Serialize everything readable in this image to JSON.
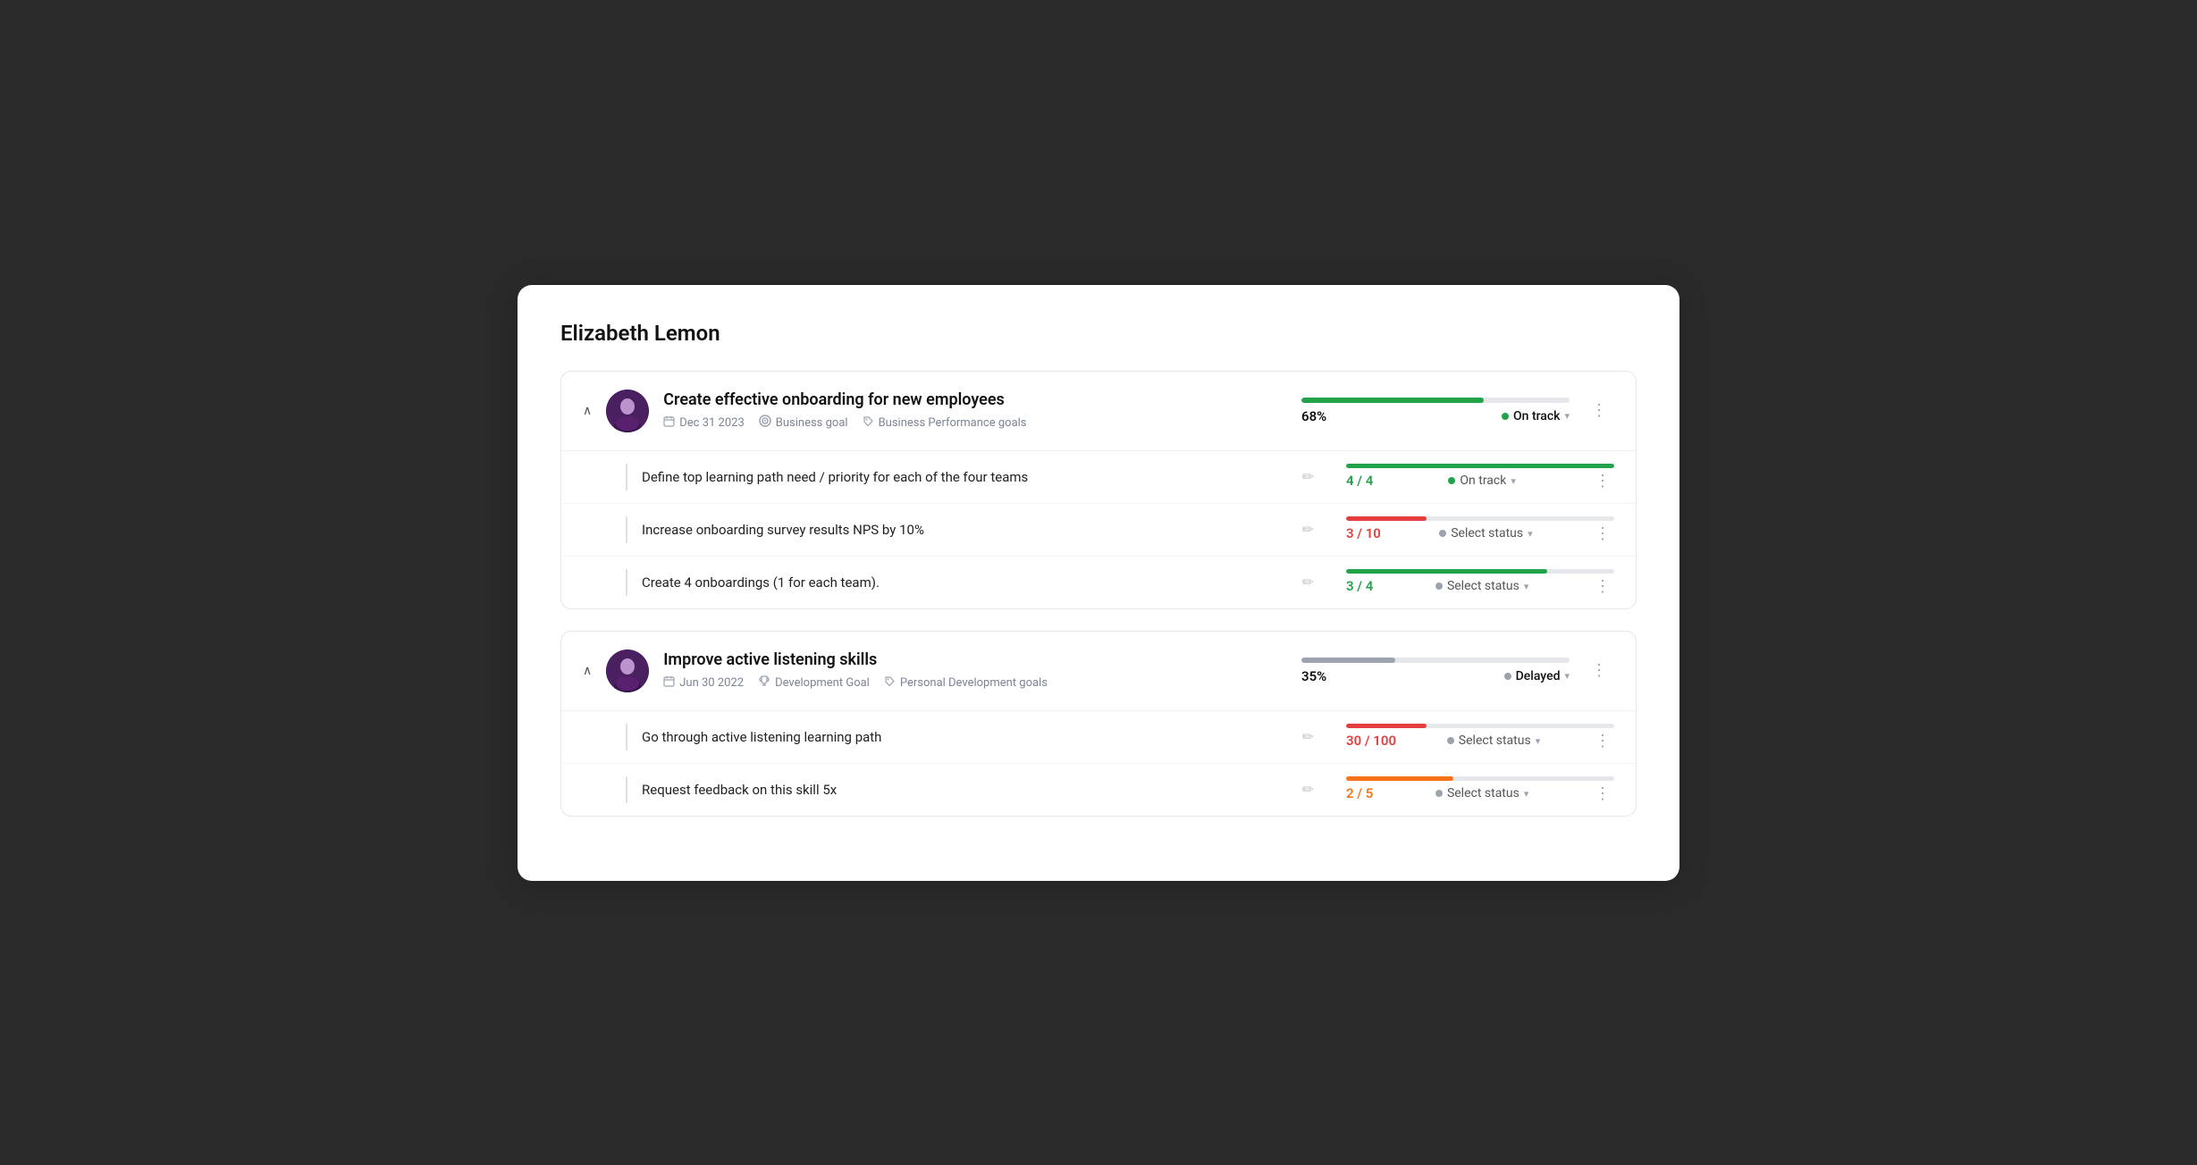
{
  "page": {
    "title": "Elizabeth Lemon",
    "background": "#2a2a2a"
  },
  "goals": [
    {
      "id": "goal-1",
      "title": "Create effective onboarding for new employees",
      "date": "Dec 31 2023",
      "type": "Business goal",
      "tag": "Business Performance goals",
      "progress_pct": 68,
      "progress_label": "68%",
      "progress_color": "#22a34a",
      "status": "On track",
      "status_dot_class": "green",
      "key_results": [
        {
          "label": "Define top learning path need / priority for each of the four teams",
          "fraction": "4 / 4",
          "fraction_class": "green",
          "fill_pct": 100,
          "fill_color": "#22a34a",
          "status": "On track",
          "status_dot": "green"
        },
        {
          "label": "Increase onboarding survey results NPS by 10%",
          "fraction": "3 / 10",
          "fraction_class": "red",
          "fill_pct": 30,
          "fill_color": "#e53e3e",
          "status": "Select status",
          "status_dot": "gray"
        },
        {
          "label": "Create 4 onboardings (1 for each team).",
          "fraction": "3 / 4",
          "fraction_class": "green",
          "fill_pct": 75,
          "fill_color": "#22a34a",
          "status": "Select status",
          "status_dot": "gray"
        }
      ]
    },
    {
      "id": "goal-2",
      "title": "Improve active listening skills",
      "date": "Jun 30 2022",
      "type": "Development Goal",
      "tag": "Personal Development goals",
      "progress_pct": 35,
      "progress_label": "35%",
      "progress_color": "#9ca3af",
      "status": "Delayed",
      "status_dot_class": "gray",
      "key_results": [
        {
          "label": "Go through active listening learning path",
          "fraction": "30 / 100",
          "fraction_class": "red",
          "fill_pct": 30,
          "fill_color": "#e53e3e",
          "status": "Select status",
          "status_dot": "gray"
        },
        {
          "label": "Request feedback on this skill 5x",
          "fraction": "2 / 5",
          "fraction_class": "orange",
          "fill_pct": 40,
          "fill_color": "#f97316",
          "status": "Select status",
          "status_dot": "gray"
        }
      ]
    }
  ]
}
